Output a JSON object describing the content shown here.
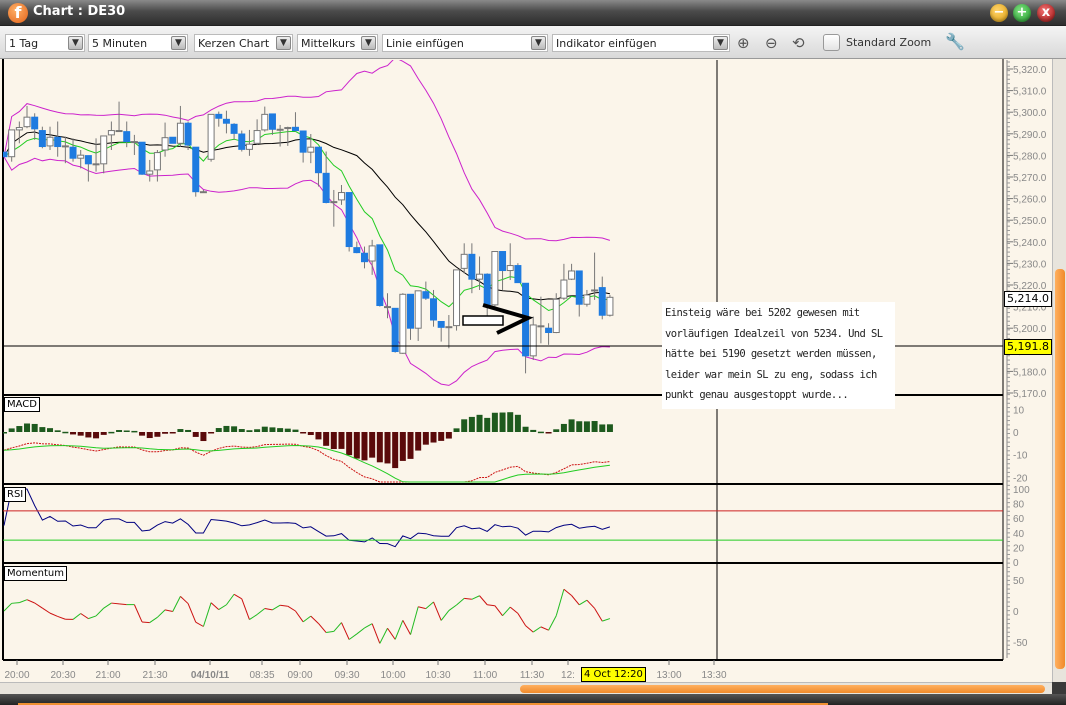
{
  "window": {
    "title": "Chart : DE30",
    "logo_glyph": "f",
    "minimize": "−",
    "maximize": "+",
    "close": "x"
  },
  "toolbar": {
    "period": "1 Tag",
    "interval": "5 Minuten",
    "chart_type": "Kerzen Chart",
    "price_type": "Mittelkurs",
    "insert_line": "Linie einfügen",
    "insert_indicator": "Indikator einfügen",
    "standard_zoom_label": "Standard Zoom",
    "standard_zoom_checked": false,
    "icons": [
      "zoom-in-icon",
      "zoom-out-icon",
      "zoom-reset-icon",
      "wrench-icon"
    ]
  },
  "annotation": "Einsteig wäre bei 5202 gewesen mit vorläufigen Idealzeil von 5234. Und SL hätte bei 5190 gesetzt werden müssen, leider war mein SL zu eng, sodass ich punkt genau ausgestoppt wurde...",
  "colors": {
    "bg": "#fbf5ea",
    "bear_candle": "#1e7be0",
    "bull_candle": "#ffffff",
    "wick": "#777777",
    "bollinger": "#cc22cc",
    "sma": "#000000",
    "ema": "#22cc22",
    "macd_pos": "#1e5a1e",
    "macd_neg": "#5a0a0a",
    "rsi": "#000080",
    "rsi_upper": "#cc2222",
    "rsi_lower": "#22cc22",
    "highlight": "#ffff00"
  },
  "chart_data": {
    "type": "candlestick",
    "symbol": "DE30",
    "ylim": [
      5165,
      5325
    ],
    "price_ticks": [
      "5,320.0",
      "5,310.0",
      "5,300.0",
      "5,290.0",
      "5,280.0",
      "5,270.0",
      "5,260.0",
      "5,250.0",
      "5,240.0",
      "5,230.0",
      "5,220.0",
      "5,210.0",
      "5,200.0",
      "5,190.0",
      "5,180.0",
      "5,170.0"
    ],
    "last_price": "5,214.0",
    "crosshair_price": "5,191.8",
    "crosshair_time": "4 Oct 12:20",
    "time_labels": [
      "20:00",
      "20:30",
      "21:00",
      "21:30",
      "04/10/11",
      "08:35",
      "09:00",
      "09:30",
      "10:00",
      "10:30",
      "11:00",
      "11:30",
      "12:",
      "13:00",
      "13:30"
    ],
    "ohlc": [
      [
        5281.5,
        5281.5,
        5279.4,
        5279.4
      ],
      [
        5279.4,
        5291.8,
        5277.1,
        5291.8
      ],
      [
        5291.8,
        5295.7,
        5285.6,
        5292.9
      ],
      [
        5293.3,
        5302.9,
        5292.6,
        5297.7
      ],
      [
        5297.7,
        5299.5,
        5287.2,
        5292.3
      ],
      [
        5291.5,
        5293.3,
        5283.3,
        5284.1
      ],
      [
        5284.4,
        5293.3,
        5282.5,
        5288.4
      ],
      [
        5288.4,
        5295.7,
        5279.4,
        5284.1
      ],
      [
        5284.4,
        5288.7,
        5276.4,
        5284.4
      ],
      [
        5283.8,
        5287.9,
        5277.1,
        5278.7
      ],
      [
        5278.7,
        5282.5,
        5274.0,
        5280.1
      ],
      [
        5279.9,
        5279.9,
        5267.9,
        5276.1
      ],
      [
        5276.1,
        5287.9,
        5272.5,
        5276.1
      ],
      [
        5276.1,
        5289.0,
        5271.7,
        5289.0
      ],
      [
        5289.5,
        5295.7,
        5282.5,
        5291.5
      ],
      [
        5291.5,
        5304.9,
        5291.0,
        5291.5
      ],
      [
        5291.0,
        5295.7,
        5283.8,
        5286.4
      ],
      [
        5286.4,
        5289.5,
        5280.2,
        5286.4
      ],
      [
        5286.1,
        5286.1,
        5271.0,
        5271.3
      ],
      [
        5271.3,
        5277.9,
        5267.9,
        5272.8
      ],
      [
        5273.3,
        5282.5,
        5267.9,
        5281.3
      ],
      [
        5282.5,
        5295.2,
        5279.4,
        5288.2
      ],
      [
        5288.4,
        5288.4,
        5285.6,
        5285.6
      ],
      [
        5285.6,
        5302.9,
        5284.1,
        5294.9
      ],
      [
        5294.9,
        5295.7,
        5282.5,
        5284.8
      ],
      [
        5283.8,
        5283.8,
        5260.9,
        5263.2
      ],
      [
        5263.2,
        5264.0,
        5262.8,
        5263.2
      ],
      [
        5278.2,
        5299.0,
        5277.1,
        5299.0
      ],
      [
        5299.0,
        5300.3,
        5293.3,
        5297.2
      ],
      [
        5296.7,
        5300.7,
        5290.2,
        5294.9
      ],
      [
        5294.4,
        5294.9,
        5287.2,
        5290.2
      ],
      [
        5289.9,
        5291.5,
        5281.8,
        5282.8
      ],
      [
        5282.8,
        5291.8,
        5279.8,
        5285.2
      ],
      [
        5285.6,
        5296.7,
        5284.8,
        5291.5
      ],
      [
        5291.8,
        5302.6,
        5291.0,
        5299.0
      ],
      [
        5299.2,
        5299.2,
        5289.5,
        5292.1
      ],
      [
        5292.1,
        5294.1,
        5284.1,
        5292.1
      ],
      [
        5292.9,
        5293.3,
        5284.4,
        5292.9
      ],
      [
        5293.0,
        5300.0,
        5291.0,
        5291.5
      ],
      [
        5291.3,
        5291.3,
        5276.7,
        5281.5
      ],
      [
        5281.5,
        5289.9,
        5276.4,
        5283.8
      ],
      [
        5283.8,
        5283.8,
        5265.6,
        5272.0
      ],
      [
        5271.7,
        5281.8,
        5257.8,
        5258.2
      ],
      [
        5258.6,
        5264.0,
        5247.0,
        5258.6
      ],
      [
        5259.4,
        5266.3,
        5257.1,
        5262.8
      ],
      [
        5262.8,
        5262.8,
        5235.5,
        5237.8
      ],
      [
        5237.3,
        5240.1,
        5234.7,
        5235.0
      ],
      [
        5234.7,
        5237.8,
        5227.7,
        5230.8
      ],
      [
        5231.1,
        5240.9,
        5224.7,
        5238.1
      ],
      [
        5238.6,
        5238.6,
        5210.0,
        5210.5
      ],
      [
        5210.0,
        5216.2,
        5204.6,
        5210.0
      ],
      [
        5209.2,
        5209.2,
        5188.7,
        5189.2
      ],
      [
        5188.4,
        5216.2,
        5188.1,
        5215.7
      ],
      [
        5215.7,
        5215.7,
        5194.6,
        5200.0
      ],
      [
        5200.0,
        5217.3,
        5194.1,
        5217.3
      ],
      [
        5216.9,
        5221.6,
        5213.1,
        5213.9
      ],
      [
        5213.6,
        5217.7,
        5200.7,
        5203.8
      ],
      [
        5203.1,
        5203.1,
        5193.8,
        5200.4
      ],
      [
        5200.7,
        5206.1,
        5190.7,
        5200.7
      ],
      [
        5201.2,
        5227.0,
        5198.9,
        5227.0
      ],
      [
        5227.7,
        5239.3,
        5225.4,
        5234.2
      ],
      [
        5234.2,
        5239.3,
        5216.2,
        5222.7
      ],
      [
        5222.7,
        5233.2,
        5217.7,
        5225.0
      ],
      [
        5225.0,
        5225.4,
        5205.4,
        5210.8
      ],
      [
        5210.8,
        5235.5,
        5208.5,
        5235.5
      ],
      [
        5235.5,
        5235.5,
        5217.7,
        5226.7
      ],
      [
        5226.7,
        5239.3,
        5222.3,
        5229.0
      ],
      [
        5229.0,
        5230.1,
        5221.1,
        5221.1
      ],
      [
        5220.8,
        5220.8,
        5179.1,
        5187.2
      ],
      [
        5187.2,
        5205.4,
        5185.3,
        5201.5
      ],
      [
        5201.1,
        5214.6,
        5193.0,
        5201.1
      ],
      [
        5200.0,
        5202.3,
        5192.3,
        5198.0
      ],
      [
        5198.0,
        5216.2,
        5197.7,
        5213.4
      ],
      [
        5213.9,
        5229.8,
        5213.1,
        5222.3
      ],
      [
        5222.7,
        5229.8,
        5222.3,
        5226.5
      ],
      [
        5226.5,
        5226.5,
        5205.4,
        5211.1
      ],
      [
        5211.1,
        5217.7,
        5210.0,
        5215.4
      ],
      [
        5217.7,
        5235.0,
        5213.1,
        5217.7
      ],
      [
        5218.8,
        5223.9,
        5204.1,
        5206.0
      ],
      [
        5206.0,
        5215.4,
        5205.4,
        5214.3
      ]
    ],
    "panels": [
      {
        "name": "MACD",
        "ticks": [
          "10",
          "0",
          "-10",
          "-20"
        ]
      },
      {
        "name": "RSI",
        "ticks": [
          "100",
          "80",
          "60",
          "40",
          "20",
          "0"
        ],
        "levels": [
          70,
          30
        ]
      },
      {
        "name": "Momentum",
        "ticks": [
          "50",
          "0",
          "-50"
        ]
      }
    ]
  }
}
